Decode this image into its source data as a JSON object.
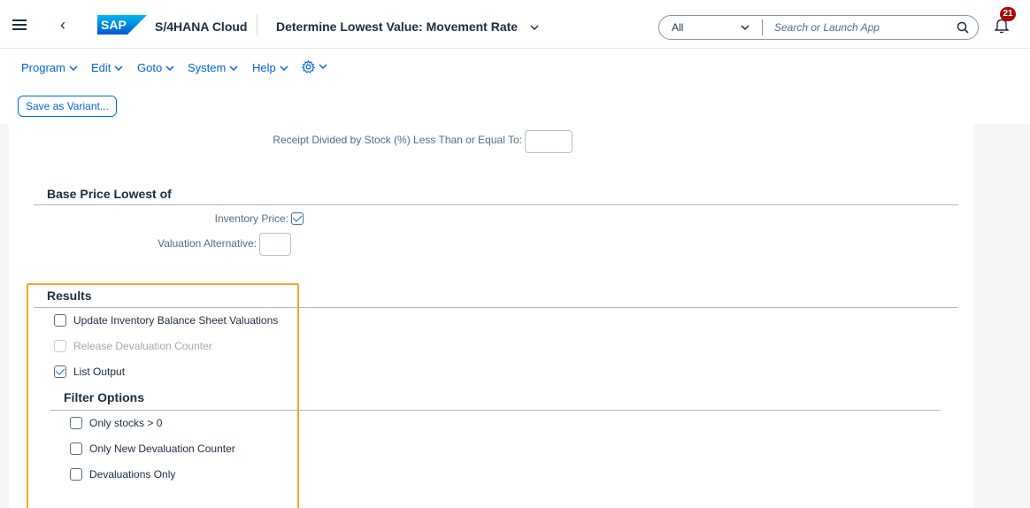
{
  "shell": {
    "app_name": "S/4HANA Cloud",
    "page_title": "Determine Lowest Value: Movement Rate",
    "search_scope": "All",
    "search_placeholder": "Search or Launch App",
    "notification_count": "21",
    "logo_text": "SAP"
  },
  "menu": {
    "items": [
      {
        "label": "Program"
      },
      {
        "label": "Edit"
      },
      {
        "label": "Goto"
      },
      {
        "label": "System"
      },
      {
        "label": "Help"
      }
    ]
  },
  "toolbar": {
    "save_variant_label": "Save as Variant..."
  },
  "form": {
    "receipt_label": "Receipt Divided by Stock (%) Less Than or Equal To:",
    "receipt_value": "",
    "base_price_title": "Base Price Lowest of",
    "inventory_price_label": "Inventory Price:",
    "inventory_price_checked": true,
    "valuation_alt_label": "Valuation Alternative:",
    "valuation_alt_value": ""
  },
  "results": {
    "title": "Results",
    "options": [
      {
        "label": "Update Inventory Balance Sheet Valuations",
        "checked": false,
        "disabled": false
      },
      {
        "label": "Release Devaluation Counter",
        "checked": false,
        "disabled": true
      },
      {
        "label": "List Output",
        "checked": true,
        "disabled": false
      }
    ],
    "filter_title": "Filter Options",
    "filters": [
      {
        "label": "Only stocks > 0",
        "checked": false
      },
      {
        "label": "Only New Devaluation Counter",
        "checked": false
      },
      {
        "label": "Devaluations Only",
        "checked": false
      }
    ]
  },
  "colors": {
    "accent": "#0064d9",
    "highlight": "#f0a830",
    "badge": "#aa0808"
  }
}
